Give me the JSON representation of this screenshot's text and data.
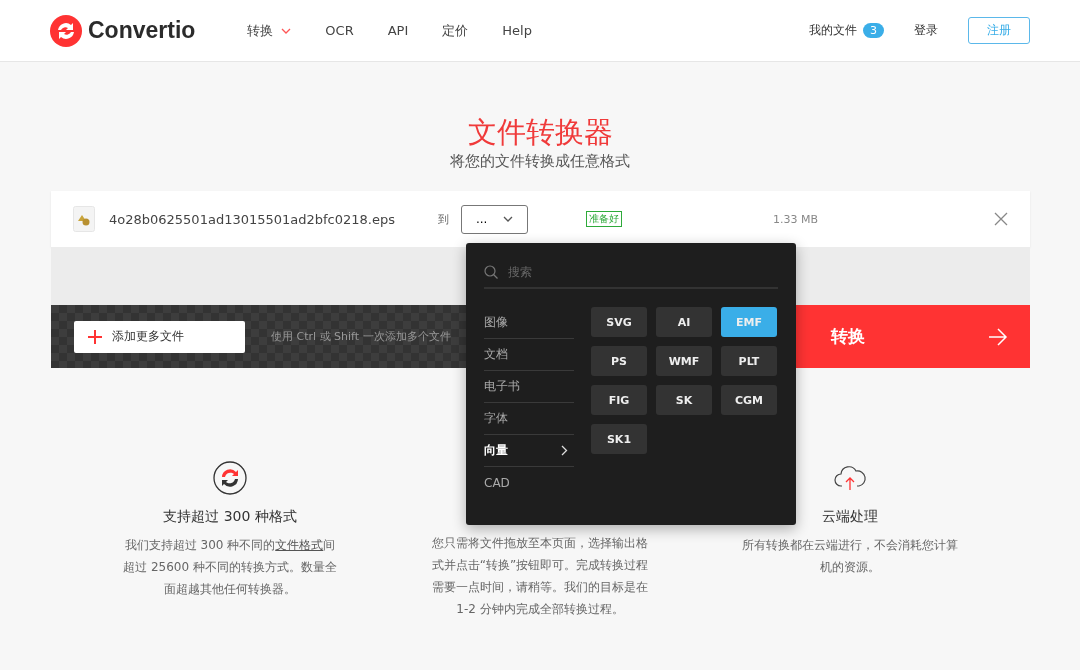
{
  "header": {
    "logo": "Convertio",
    "nav": [
      {
        "label": "转换",
        "kind": "menu"
      },
      {
        "label": "OCR",
        "kind": "link"
      },
      {
        "label": "API",
        "kind": "link"
      },
      {
        "label": "定价",
        "kind": "link"
      },
      {
        "label": "Help",
        "kind": "link"
      }
    ],
    "my_files": {
      "label": "我的文件",
      "count": "3"
    },
    "login": "登录",
    "signup": "注册"
  },
  "hero": {
    "title": "文件转换器",
    "subtitle": "将您的文件转换成任意格式"
  },
  "file": {
    "name": "4o28b0625501ad13015501ad2bfc0218.eps",
    "to_label": "到",
    "format_select": "...",
    "status": "准备好",
    "size": "1.33 MB"
  },
  "actions": {
    "add_button": "添加更多文件",
    "hint": "使用 Ctrl 或 Shift 一次添加多个文件",
    "convert_button": "转换"
  },
  "dropdown": {
    "placeholder": "搜索",
    "categories": [
      {
        "label": "图像",
        "selected": false
      },
      {
        "label": "文档",
        "selected": false
      },
      {
        "label": "电子书",
        "selected": false
      },
      {
        "label": "字体",
        "selected": false
      },
      {
        "label": "向量",
        "selected": true
      },
      {
        "label": "CAD",
        "selected": false
      }
    ],
    "formats": [
      {
        "label": "SVG",
        "selected": false
      },
      {
        "label": "AI",
        "selected": false
      },
      {
        "label": "EMF",
        "selected": true
      },
      {
        "label": "PS",
        "selected": false
      },
      {
        "label": "WMF",
        "selected": false
      },
      {
        "label": "PLT",
        "selected": false
      },
      {
        "label": "FIG",
        "selected": false
      },
      {
        "label": "SK",
        "selected": false
      },
      {
        "label": "CGM",
        "selected": false
      },
      {
        "label": "SK1",
        "selected": false
      }
    ]
  },
  "features": [
    {
      "title": "支持超过 300 种格式",
      "text_before": "我们支持超过 300 种不同的",
      "link": "文件格式",
      "text_after": "间超过 25600 种不同的转换方式。数量全面超越其他任何转换器。"
    },
    {
      "text_before": "您只需将文件拖放至本页面，选择输出格式并点击“转换”按钮即可。完成转换过程需要一点时间，请稍等。我们的目标是在 1-2 分钟内完成全部转换过程。"
    },
    {
      "title": "云端处理",
      "text_before": "所有转换都在云端进行，不会消耗您计算机的资源。"
    }
  ]
}
